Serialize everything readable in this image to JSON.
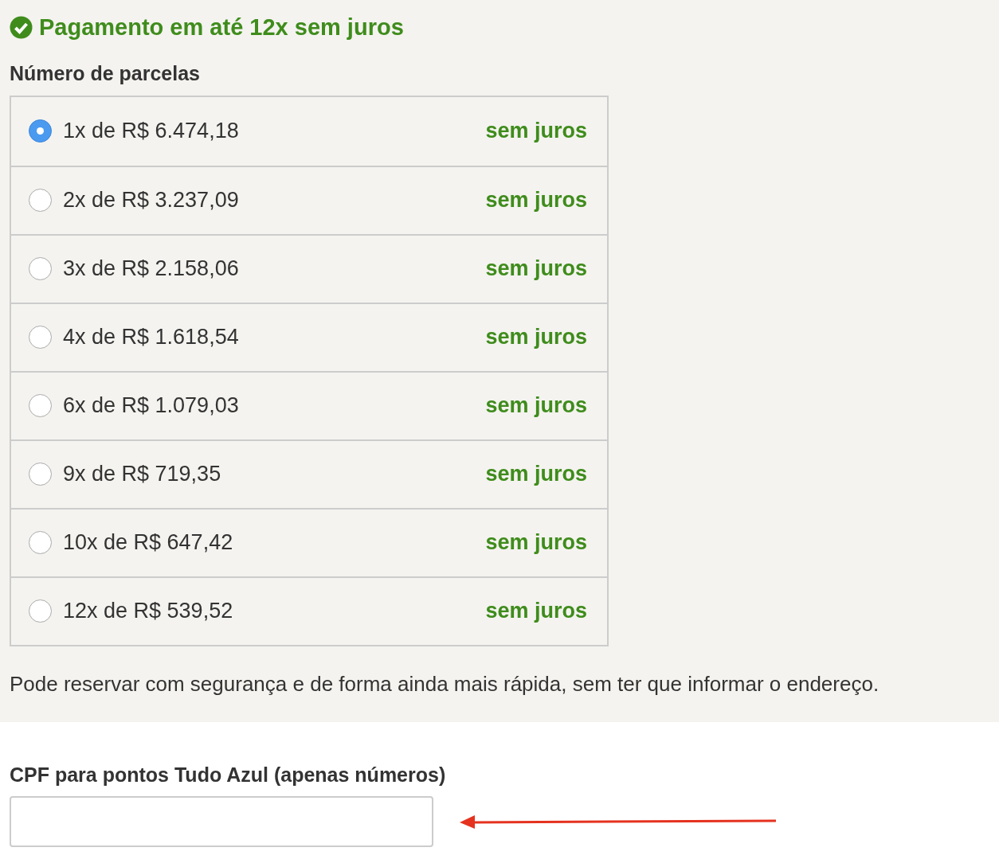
{
  "heading": "Pagamento em até 12x sem juros",
  "installments_label": "Número de parcelas",
  "installments": [
    {
      "text": "1x de R$ 6.474,18",
      "note": "sem juros",
      "selected": true
    },
    {
      "text": "2x de R$ 3.237,09",
      "note": "sem juros",
      "selected": false
    },
    {
      "text": "3x de R$ 2.158,06",
      "note": "sem juros",
      "selected": false
    },
    {
      "text": "4x de R$ 1.618,54",
      "note": "sem juros",
      "selected": false
    },
    {
      "text": "6x de R$ 1.079,03",
      "note": "sem juros",
      "selected": false
    },
    {
      "text": "9x de R$ 719,35",
      "note": "sem juros",
      "selected": false
    },
    {
      "text": "10x de R$ 647,42",
      "note": "sem juros",
      "selected": false
    },
    {
      "text": "12x de R$ 539,52",
      "note": "sem juros",
      "selected": false
    }
  ],
  "info": "Pode reservar com segurança e de forma ainda mais rápida, sem ter que informar o endereço.",
  "cpf_label": "CPF para pontos Tudo Azul (apenas números)",
  "annotation": {
    "kind": "arrow"
  }
}
